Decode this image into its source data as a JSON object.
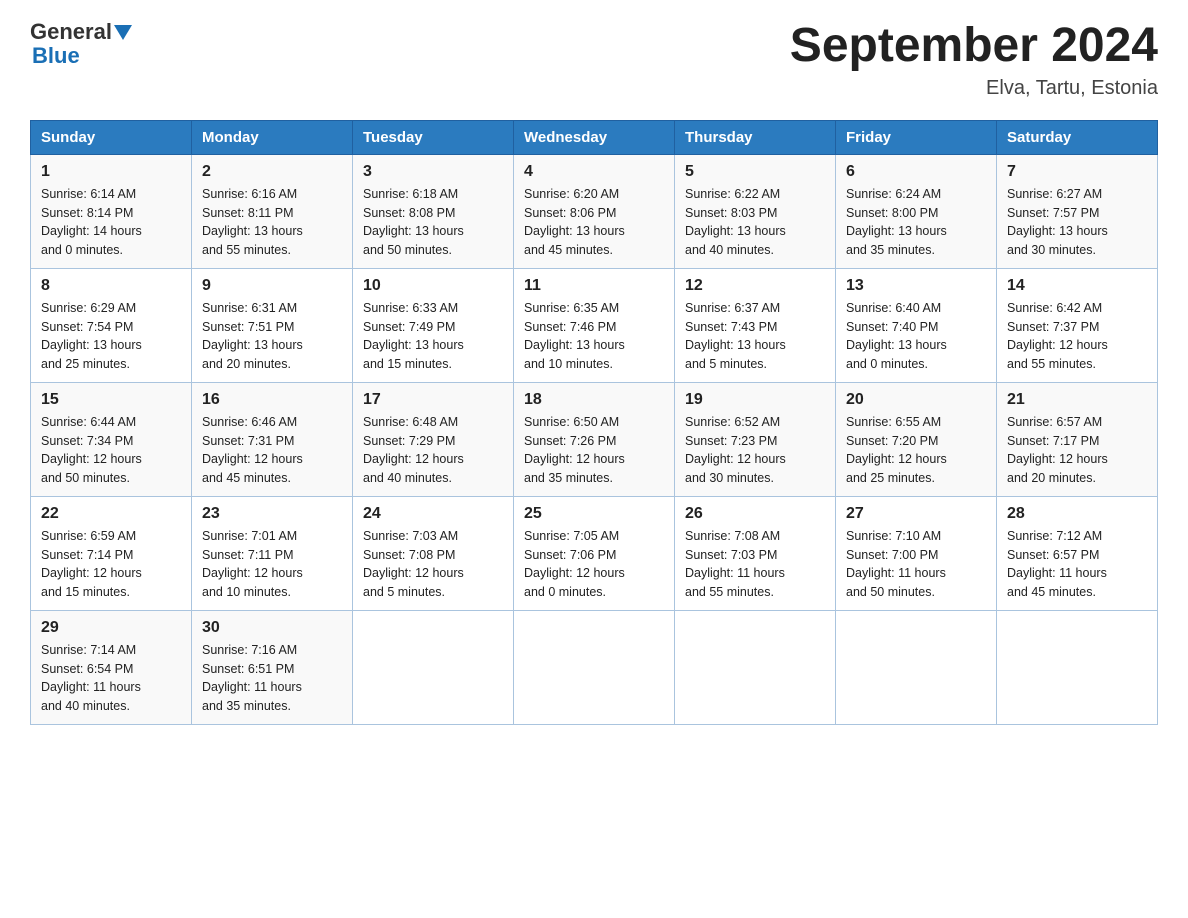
{
  "header": {
    "logo_general": "General",
    "logo_blue": "Blue",
    "title": "September 2024",
    "subtitle": "Elva, Tartu, Estonia"
  },
  "weekdays": [
    "Sunday",
    "Monday",
    "Tuesday",
    "Wednesday",
    "Thursday",
    "Friday",
    "Saturday"
  ],
  "weeks": [
    [
      {
        "day": "1",
        "sunrise": "Sunrise: 6:14 AM",
        "sunset": "Sunset: 8:14 PM",
        "daylight": "Daylight: 14 hours",
        "daylight2": "and 0 minutes."
      },
      {
        "day": "2",
        "sunrise": "Sunrise: 6:16 AM",
        "sunset": "Sunset: 8:11 PM",
        "daylight": "Daylight: 13 hours",
        "daylight2": "and 55 minutes."
      },
      {
        "day": "3",
        "sunrise": "Sunrise: 6:18 AM",
        "sunset": "Sunset: 8:08 PM",
        "daylight": "Daylight: 13 hours",
        "daylight2": "and 50 minutes."
      },
      {
        "day": "4",
        "sunrise": "Sunrise: 6:20 AM",
        "sunset": "Sunset: 8:06 PM",
        "daylight": "Daylight: 13 hours",
        "daylight2": "and 45 minutes."
      },
      {
        "day": "5",
        "sunrise": "Sunrise: 6:22 AM",
        "sunset": "Sunset: 8:03 PM",
        "daylight": "Daylight: 13 hours",
        "daylight2": "and 40 minutes."
      },
      {
        "day": "6",
        "sunrise": "Sunrise: 6:24 AM",
        "sunset": "Sunset: 8:00 PM",
        "daylight": "Daylight: 13 hours",
        "daylight2": "and 35 minutes."
      },
      {
        "day": "7",
        "sunrise": "Sunrise: 6:27 AM",
        "sunset": "Sunset: 7:57 PM",
        "daylight": "Daylight: 13 hours",
        "daylight2": "and 30 minutes."
      }
    ],
    [
      {
        "day": "8",
        "sunrise": "Sunrise: 6:29 AM",
        "sunset": "Sunset: 7:54 PM",
        "daylight": "Daylight: 13 hours",
        "daylight2": "and 25 minutes."
      },
      {
        "day": "9",
        "sunrise": "Sunrise: 6:31 AM",
        "sunset": "Sunset: 7:51 PM",
        "daylight": "Daylight: 13 hours",
        "daylight2": "and 20 minutes."
      },
      {
        "day": "10",
        "sunrise": "Sunrise: 6:33 AM",
        "sunset": "Sunset: 7:49 PM",
        "daylight": "Daylight: 13 hours",
        "daylight2": "and 15 minutes."
      },
      {
        "day": "11",
        "sunrise": "Sunrise: 6:35 AM",
        "sunset": "Sunset: 7:46 PM",
        "daylight": "Daylight: 13 hours",
        "daylight2": "and 10 minutes."
      },
      {
        "day": "12",
        "sunrise": "Sunrise: 6:37 AM",
        "sunset": "Sunset: 7:43 PM",
        "daylight": "Daylight: 13 hours",
        "daylight2": "and 5 minutes."
      },
      {
        "day": "13",
        "sunrise": "Sunrise: 6:40 AM",
        "sunset": "Sunset: 7:40 PM",
        "daylight": "Daylight: 13 hours",
        "daylight2": "and 0 minutes."
      },
      {
        "day": "14",
        "sunrise": "Sunrise: 6:42 AM",
        "sunset": "Sunset: 7:37 PM",
        "daylight": "Daylight: 12 hours",
        "daylight2": "and 55 minutes."
      }
    ],
    [
      {
        "day": "15",
        "sunrise": "Sunrise: 6:44 AM",
        "sunset": "Sunset: 7:34 PM",
        "daylight": "Daylight: 12 hours",
        "daylight2": "and 50 minutes."
      },
      {
        "day": "16",
        "sunrise": "Sunrise: 6:46 AM",
        "sunset": "Sunset: 7:31 PM",
        "daylight": "Daylight: 12 hours",
        "daylight2": "and 45 minutes."
      },
      {
        "day": "17",
        "sunrise": "Sunrise: 6:48 AM",
        "sunset": "Sunset: 7:29 PM",
        "daylight": "Daylight: 12 hours",
        "daylight2": "and 40 minutes."
      },
      {
        "day": "18",
        "sunrise": "Sunrise: 6:50 AM",
        "sunset": "Sunset: 7:26 PM",
        "daylight": "Daylight: 12 hours",
        "daylight2": "and 35 minutes."
      },
      {
        "day": "19",
        "sunrise": "Sunrise: 6:52 AM",
        "sunset": "Sunset: 7:23 PM",
        "daylight": "Daylight: 12 hours",
        "daylight2": "and 30 minutes."
      },
      {
        "day": "20",
        "sunrise": "Sunrise: 6:55 AM",
        "sunset": "Sunset: 7:20 PM",
        "daylight": "Daylight: 12 hours",
        "daylight2": "and 25 minutes."
      },
      {
        "day": "21",
        "sunrise": "Sunrise: 6:57 AM",
        "sunset": "Sunset: 7:17 PM",
        "daylight": "Daylight: 12 hours",
        "daylight2": "and 20 minutes."
      }
    ],
    [
      {
        "day": "22",
        "sunrise": "Sunrise: 6:59 AM",
        "sunset": "Sunset: 7:14 PM",
        "daylight": "Daylight: 12 hours",
        "daylight2": "and 15 minutes."
      },
      {
        "day": "23",
        "sunrise": "Sunrise: 7:01 AM",
        "sunset": "Sunset: 7:11 PM",
        "daylight": "Daylight: 12 hours",
        "daylight2": "and 10 minutes."
      },
      {
        "day": "24",
        "sunrise": "Sunrise: 7:03 AM",
        "sunset": "Sunset: 7:08 PM",
        "daylight": "Daylight: 12 hours",
        "daylight2": "and 5 minutes."
      },
      {
        "day": "25",
        "sunrise": "Sunrise: 7:05 AM",
        "sunset": "Sunset: 7:06 PM",
        "daylight": "Daylight: 12 hours",
        "daylight2": "and 0 minutes."
      },
      {
        "day": "26",
        "sunrise": "Sunrise: 7:08 AM",
        "sunset": "Sunset: 7:03 PM",
        "daylight": "Daylight: 11 hours",
        "daylight2": "and 55 minutes."
      },
      {
        "day": "27",
        "sunrise": "Sunrise: 7:10 AM",
        "sunset": "Sunset: 7:00 PM",
        "daylight": "Daylight: 11 hours",
        "daylight2": "and 50 minutes."
      },
      {
        "day": "28",
        "sunrise": "Sunrise: 7:12 AM",
        "sunset": "Sunset: 6:57 PM",
        "daylight": "Daylight: 11 hours",
        "daylight2": "and 45 minutes."
      }
    ],
    [
      {
        "day": "29",
        "sunrise": "Sunrise: 7:14 AM",
        "sunset": "Sunset: 6:54 PM",
        "daylight": "Daylight: 11 hours",
        "daylight2": "and 40 minutes."
      },
      {
        "day": "30",
        "sunrise": "Sunrise: 7:16 AM",
        "sunset": "Sunset: 6:51 PM",
        "daylight": "Daylight: 11 hours",
        "daylight2": "and 35 minutes."
      },
      null,
      null,
      null,
      null,
      null
    ]
  ]
}
